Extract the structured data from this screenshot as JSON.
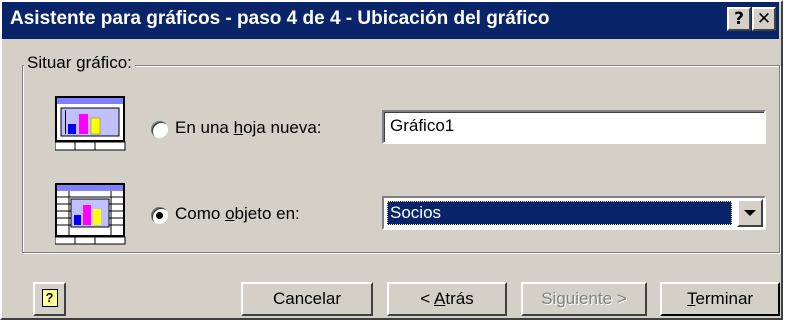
{
  "window": {
    "title": "Asistente para gráficos - paso 4 de 4 - Ubicación del gráfico",
    "help_glyph": "?",
    "close_glyph": "✕"
  },
  "group": {
    "label": "Situar gráfico:"
  },
  "options": {
    "new_sheet": {
      "label_pre": "En una ",
      "label_u": "h",
      "label_post": "oja nueva:",
      "selected": false,
      "value": "Gráfico1",
      "icon": "chart-sheet-icon"
    },
    "as_object": {
      "label_pre": "Como ",
      "label_u": "o",
      "label_post": "bjeto en:",
      "selected": true,
      "value": "Socios",
      "icon": "embedded-chart-icon"
    }
  },
  "buttons": {
    "help": "?",
    "cancel": "Cancelar",
    "back_pre": "< ",
    "back_u": "A",
    "back_post": "trás",
    "next": "Siguiente >",
    "finish_u": "T",
    "finish_post": "erminar"
  },
  "colors": {
    "titlebar": "#0a246a",
    "face": "#d4d0c8",
    "selection": "#0a246a",
    "bar_blue": "#0000ff",
    "bar_magenta": "#ff00ff",
    "bar_yellow": "#ffff00"
  }
}
